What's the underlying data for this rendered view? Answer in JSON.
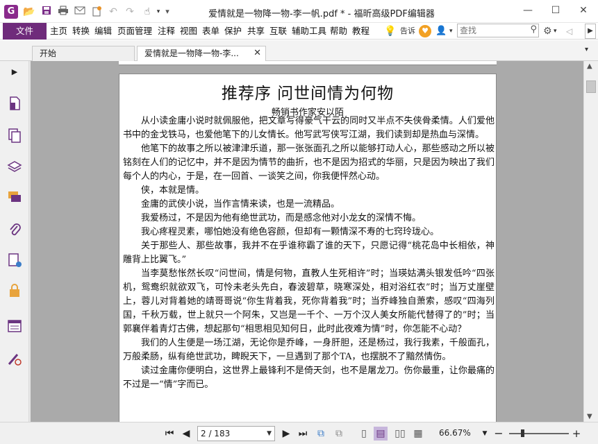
{
  "app": {
    "window_title": "爱情就是一物降一物-李一帆.pdf * - 福昕高级PDF编辑器",
    "logo_letter": "G"
  },
  "quick_access": {
    "icons": [
      "open-folder-icon",
      "save-icon",
      "print-icon",
      "email-icon",
      "new-icon",
      "undo-icon",
      "redo-icon",
      "hand-tool-icon"
    ]
  },
  "menu": {
    "file_label": "文件",
    "items": [
      "主页",
      "转换",
      "编辑",
      "页面管理",
      "注释",
      "视图",
      "表单",
      "保护",
      "共享",
      "互联",
      "辅助工具",
      "帮助",
      "教程"
    ],
    "tell_me": "告诉",
    "search_placeholder": "查找"
  },
  "tabs": {
    "start_label": "开始",
    "doc_label": "爱情就是一物降一物-李...",
    "close_symbol": "✕"
  },
  "document": {
    "title": "推荐序   问世间情为何物",
    "subtitle": "畅销书作家安以陌",
    "paragraphs": [
      "从小读金庸小说时就佩服他，把文章写得豪气干云的同时又半点不失侠骨柔情。人们爱他书中的金戈铁马，也爱他笔下的儿女情长。他写武写侠写江湖，我们读到却是热血与深情。",
      "他笔下的故事之所以被津津乐道，那一张张面孔之所以能够打动人心，那些感动之所以被铭刻在人们的记忆中，并不是因为情节的曲折，也不是因为招式的华丽，只是因为映出了我们每个人的内心，于是，在一回首、一谈笑之间，你我便怦然心动。",
      "侠，本就是情。",
      "金庸的武侠小说，当作言情来读，也是一流精品。",
      "我爱杨过，不是因为他有绝世武功，而是感念他对小龙女的深情不悔。",
      "我心疼程灵素，哪怕她没有绝色容颜，但却有一颗情深不寿的七窍玲珑心。",
      "关于那些人、那些故事，我并不在乎谁称霸了谁的天下，只愿记得“桃花岛中长相依，神雕背上比翼飞。”",
      "当李莫愁怅然长叹“问世间，情是何物，直教人生死相许”时；当瑛姑满头银发低吟“四张机，鸳鸯织就欲双飞，可怜未老头先白，春波碧草，晓寒深处，相对浴红衣”时；当万丈崖壁上，蓉儿对背着她的靖哥哥说“你生背着我，死你背着我”时；当乔峰独自萧索，感叹“四海列国，千秋万载，世上就只一个阿朱，又岂是一千个、一万个汉人美女所能代替得了的”时；当郭襄伴着青灯古佛，想起那句“相思相见知何日，此时此夜难为情”时，你怎能不心动？",
      "我们的人生便是一场江湖，无论你是乔峰，一身肝胆，还是杨过，我行我素，千般面孔，万般柔肠，纵有绝世武功，睥睨天下，一旦遇到了那个TA，也摆脱不了黯然情伤。",
      "读过金庸你便明白，这世界上最锋利不是倚天剑，也不是屠龙刀。伤你最重，让你最痛的不过是一“情”字而已。"
    ]
  },
  "status": {
    "page_indicator": "2 / 183",
    "zoom": "66.67%",
    "zoom_fraction": 0.22
  },
  "colors": {
    "brand": "#6f2b7b",
    "accent_bar": "#f0a400",
    "doc_background": "#aaaaaa"
  }
}
